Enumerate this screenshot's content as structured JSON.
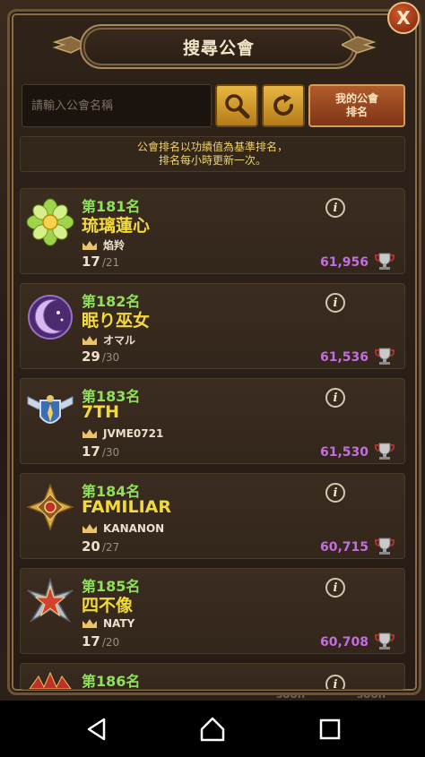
{
  "header": {
    "title": "搜尋公會",
    "close_label": "X"
  },
  "search": {
    "placeholder": "請輸入公會名稱",
    "my_guild_rank_line1": "我的公會",
    "my_guild_rank_line2": "排名"
  },
  "notice": {
    "line1": "公會排名以功績值為基準排名，",
    "line2": "排名每小時更新一次。"
  },
  "background": {
    "soon_left": "soon",
    "soon_right": "soon"
  },
  "guilds": [
    {
      "rank": "第181名",
      "name": "琉璃蓮心",
      "leader": "焰羚",
      "members": "17",
      "max_members": "/21",
      "score": "61,956",
      "emblem_icon": "flower-emblem-icon"
    },
    {
      "rank": "第182名",
      "name": "眠り巫女",
      "leader": "オマル",
      "members": "29",
      "max_members": "/30",
      "score": "61,536",
      "emblem_icon": "moon-emblem-icon"
    },
    {
      "rank": "第183名",
      "name": "7TH",
      "leader": "JVME0721",
      "members": "17",
      "max_members": "/30",
      "score": "61,530",
      "emblem_icon": "winged-shield-emblem-icon"
    },
    {
      "rank": "第184名",
      "name": "FAMILIAR",
      "leader": "KANANON",
      "members": "20",
      "max_members": "/27",
      "score": "60,715",
      "emblem_icon": "gold-cross-emblem-icon"
    },
    {
      "rank": "第185名",
      "name": "四不像",
      "leader": "NATY",
      "members": "17",
      "max_members": "/20",
      "score": "60,708",
      "emblem_icon": "star-emblem-icon"
    },
    {
      "rank": "第186名",
      "emblem_icon": "crown-emblem-icon"
    }
  ],
  "colors": {
    "rank": "#8fe05a",
    "name": "#f1da3a",
    "score": "#c46de0",
    "accent": "#e9b743"
  }
}
